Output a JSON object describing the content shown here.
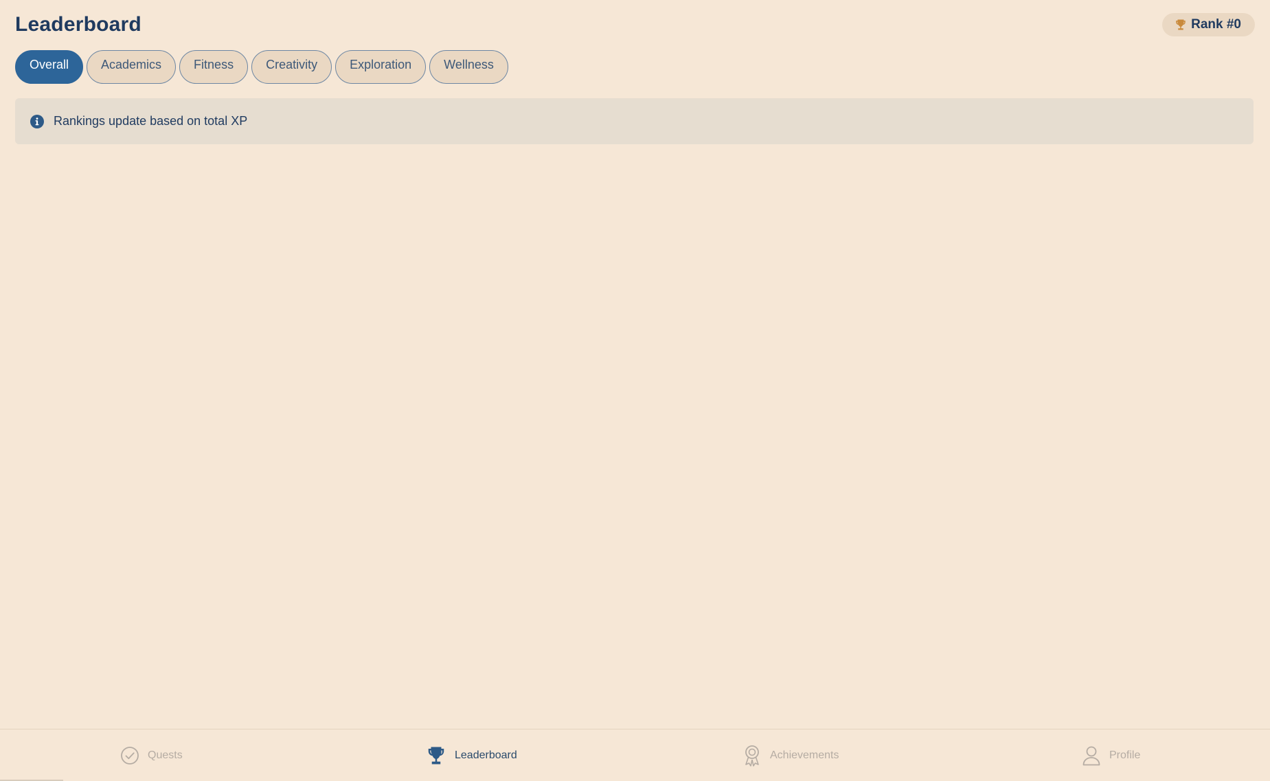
{
  "header": {
    "title": "Leaderboard",
    "rank_label": "Rank #0",
    "rank_icon": "trophy-icon"
  },
  "tabs": [
    {
      "label": "Overall",
      "active": true
    },
    {
      "label": "Academics",
      "active": false
    },
    {
      "label": "Fitness",
      "active": false
    },
    {
      "label": "Creativity",
      "active": false
    },
    {
      "label": "Exploration",
      "active": false
    },
    {
      "label": "Wellness",
      "active": false
    }
  ],
  "info": {
    "icon": "info-icon",
    "text": "Rankings update based on total XP"
  },
  "bottom_nav": {
    "items": [
      {
        "label": "Quests",
        "icon": "check-circle-icon",
        "active": false
      },
      {
        "label": "Leaderboard",
        "icon": "trophy-icon",
        "active": true
      },
      {
        "label": "Achievements",
        "icon": "award-icon",
        "active": false
      },
      {
        "label": "Profile",
        "icon": "user-icon",
        "active": false
      }
    ]
  },
  "colors": {
    "background": "#f6e7d6",
    "primary": "#2d6599",
    "title": "#1f3a5f",
    "trophy_gold": "#c98a3c",
    "inactive_nav": "#b5aca3"
  }
}
